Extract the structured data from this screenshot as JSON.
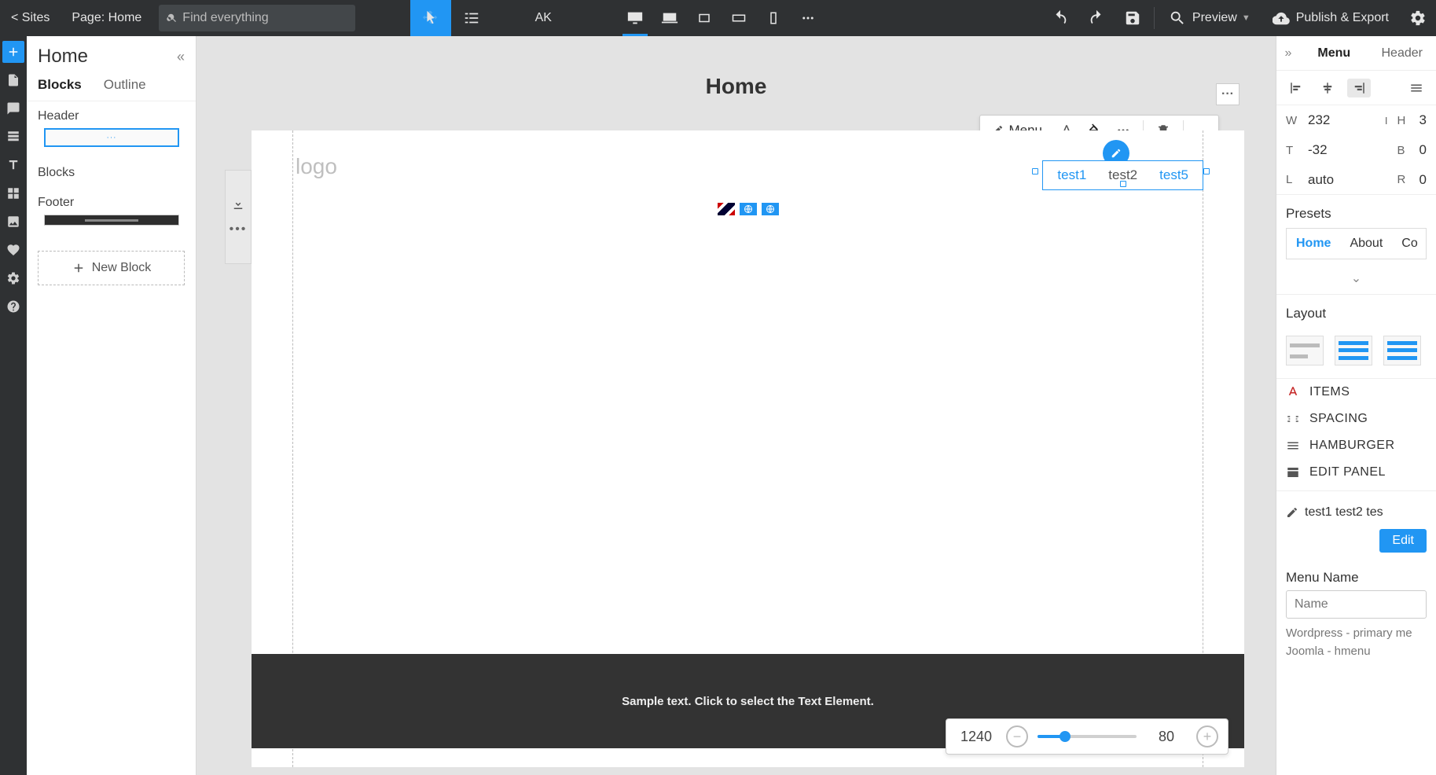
{
  "topbar": {
    "sites_label": "< Sites",
    "page_label": "Page: Home",
    "search_placeholder": "Find everything",
    "user_initials": "AK",
    "preview_label": "Preview",
    "publish_label": "Publish & Export"
  },
  "leftpanel": {
    "title": "Home",
    "tab_blocks": "Blocks",
    "tab_outline": "Outline",
    "sec_header": "Header",
    "sec_blocks": "Blocks",
    "sec_footer": "Footer",
    "new_block": "New Block"
  },
  "canvas": {
    "page_title": "Home",
    "logo_text": "logo",
    "menu_items": [
      "test1",
      "test2",
      "test5"
    ],
    "footer_text": "Sample text. Click to select the Text Element.",
    "ctx_label": "Menu"
  },
  "zoom": {
    "canvas_width": "1240",
    "percent": "80"
  },
  "rightpanel": {
    "tab_menu": "Menu",
    "tab_header": "Header",
    "w_label": "W",
    "w_value": "232",
    "h_label": "H",
    "h_value": "3",
    "t_label": "T",
    "t_value": "-32",
    "b_label": "B",
    "b_value": "0",
    "l_label": "L",
    "l_value": "auto",
    "r_label": "R",
    "r_value": "0",
    "presets_title": "Presets",
    "preset_home": "Home",
    "preset_about": "About",
    "preset_contact": "Co",
    "layout_title": "Layout",
    "prop_items": "ITEMS",
    "prop_spacing": "SPACING",
    "prop_hamburger": "HAMBURGER",
    "prop_editpanel": "EDIT PANEL",
    "edit_items_text": "test1 test2 tes",
    "edit_button": "Edit",
    "menu_name_label": "Menu Name",
    "menu_name_placeholder": "Name",
    "hint1": "Wordpress - primary me",
    "hint2": "Joomla - hmenu"
  }
}
